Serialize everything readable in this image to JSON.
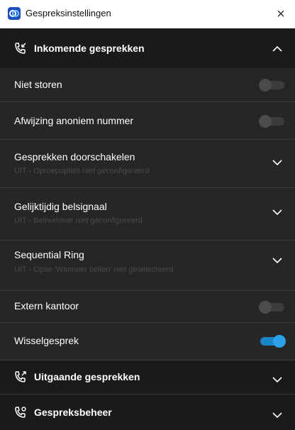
{
  "window": {
    "title": "Gespreksinstellingen",
    "close_glyph": "×",
    "app_icon": "app-logo-icon"
  },
  "sections": {
    "incoming": {
      "label": "Inkomende gesprekken",
      "icon": "incoming-call-icon",
      "expanded": true
    },
    "outgoing": {
      "label": "Uitgaande gesprekken",
      "icon": "outgoing-call-icon",
      "expanded": false
    },
    "management": {
      "label": "Gespreksbeheer",
      "icon": "call-settings-icon",
      "expanded": false
    }
  },
  "incoming_items": {
    "dnd": {
      "label": "Niet storen",
      "enabled": false
    },
    "anon": {
      "label": "Afwijzing anoniem nummer",
      "enabled": false
    },
    "forward": {
      "label": "Gesprekken doorschakelen",
      "subtitle": "UIT - Oproepopties niet geconfigureerd"
    },
    "simring": {
      "label": "Gelijktijdig belsignaal",
      "subtitle": "UIT - Belnummer niet geconfigureerd"
    },
    "seqring": {
      "label": "Sequential Ring",
      "subtitle": "UIT - Optie 'Wanneer bellen' niet geselecteerd"
    },
    "remote_office": {
      "label": "Extern kantoor",
      "enabled": false
    },
    "call_waiting": {
      "label": "Wisselgesprek",
      "enabled": true
    }
  },
  "colors": {
    "accent": "#1a85c7",
    "panel_background": "#1e1e1e",
    "toggle_off": "#3c3c3c"
  }
}
